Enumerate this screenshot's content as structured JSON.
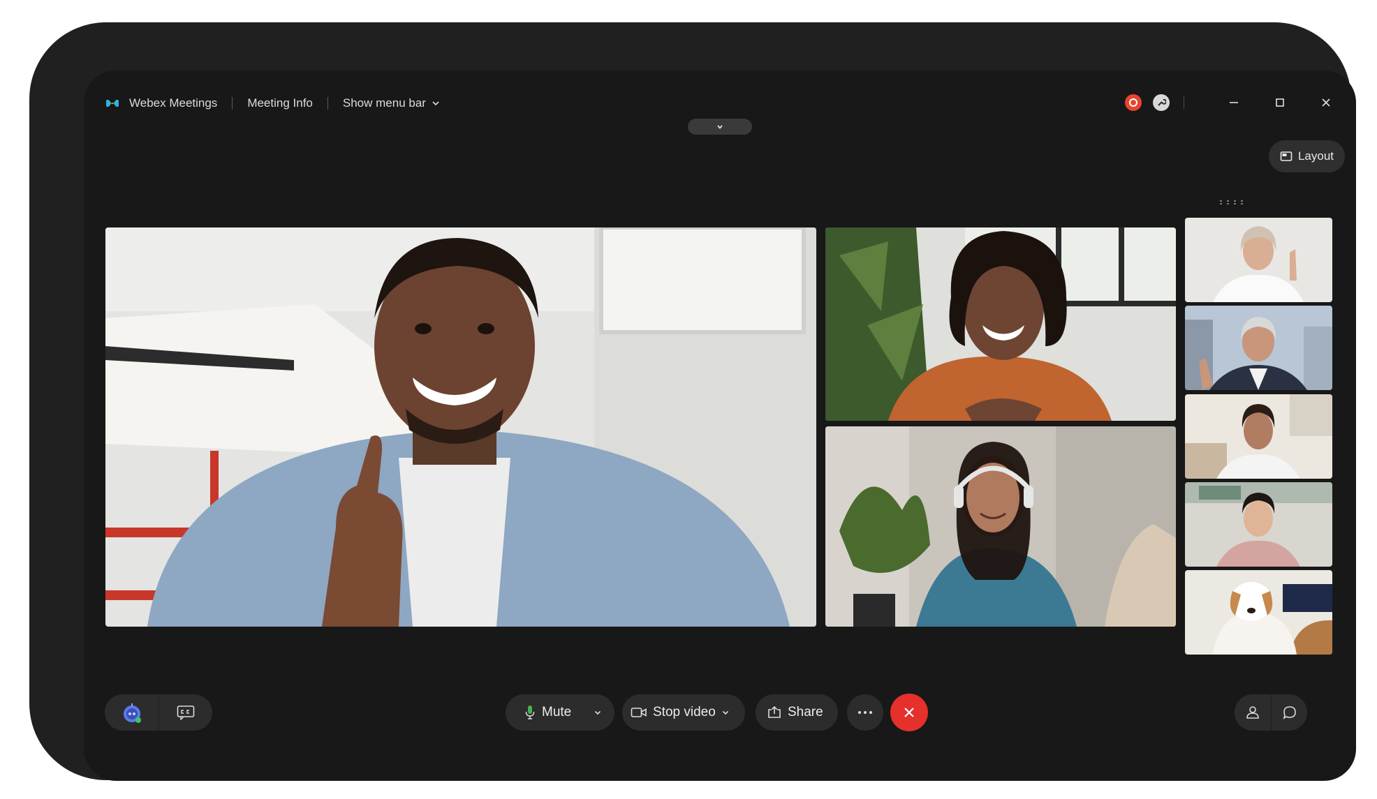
{
  "app": {
    "title": "Webex Meetings",
    "meeting_info": "Meeting Info",
    "show_menu_bar": "Show menu bar"
  },
  "header": {
    "layout_label": "Layout"
  },
  "controls": {
    "mute_label": "Mute",
    "stop_video_label": "Stop video",
    "share_label": "Share",
    "more_label": "···"
  },
  "icons": {
    "app_logo": "webex-logo-icon",
    "chevron": "chevron-down-icon",
    "recording": "recording-icon",
    "tools": "tools-icon",
    "minimize": "minimize-icon",
    "maximize": "maximize-icon",
    "close": "close-icon",
    "layout": "layout-icon",
    "ai_assistant": "ai-assistant-icon",
    "captions": "closed-captions-icon",
    "microphone": "microphone-icon",
    "camera": "camera-icon",
    "share": "share-icon",
    "end_call": "end-call-icon",
    "participants": "participants-icon",
    "chat": "chat-icon"
  },
  "colors": {
    "background": "#181818",
    "frame": "#202020",
    "pill": "#2c2c2c",
    "end_call": "#e5302b",
    "recording": "#e8452e",
    "mic_active": "#4caf50"
  },
  "video_grid": {
    "main_participant": "participant-1",
    "stage_tiles": 3,
    "filmstrip_tiles": 5
  }
}
